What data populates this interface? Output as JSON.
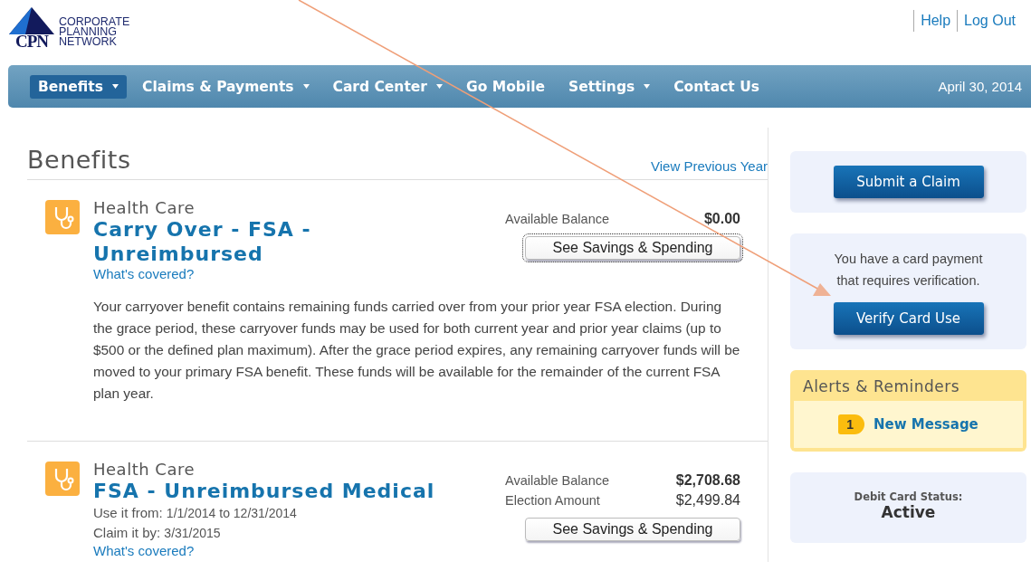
{
  "logo": {
    "mark": "CPN",
    "name_lines": [
      "CORPORATE",
      "PLANNING",
      "NETWORK"
    ]
  },
  "top_links": [
    "Help",
    "Log Out"
  ],
  "nav": {
    "items": [
      {
        "label": "Benefits",
        "selected": true,
        "has_menu": true
      },
      {
        "label": "Claims & Payments",
        "selected": false,
        "has_menu": true
      },
      {
        "label": "Card Center",
        "selected": false,
        "has_menu": true
      },
      {
        "label": "Go Mobile",
        "selected": false,
        "has_menu": false
      },
      {
        "label": "Settings",
        "selected": false,
        "has_menu": true
      },
      {
        "label": "Contact Us",
        "selected": false,
        "has_menu": false
      }
    ],
    "date": "April 30, 2014"
  },
  "page_title": "Benefits",
  "previous_year_link": "View Previous Year",
  "plans": [
    {
      "category": "Health Care",
      "title": "Carry Over - FSA - Unreimbursed",
      "covered_link": "What's covered?",
      "amounts": [
        {
          "label": "Available Balance",
          "value": "$0.00",
          "emphasis": true
        }
      ],
      "button": {
        "label": "See Savings & Spending",
        "focused": true
      },
      "description": "Your carryover benefit contains remaining funds carried over from your prior year FSA election. During the grace period, these carryover funds may be used for both current year and prior year claims (up to $500 or the defined plan maximum). After the grace period expires, any remaining carryover funds will be moved to your primary FSA benefit. These funds will be available for the remainder of the current FSA plan year."
    },
    {
      "category": "Health Care",
      "title": "FSA - Unreimbursed Medical",
      "details": [
        {
          "label": "Use it from:",
          "value": "1/1/2014 to 12/31/2014"
        },
        {
          "label": "Claim it by:",
          "value": "3/31/2015"
        }
      ],
      "covered_link": "What's covered?",
      "amounts": [
        {
          "label": "Available Balance",
          "value": "$2,708.68",
          "emphasis": true
        },
        {
          "label": "Election Amount",
          "value": "$2,499.84",
          "emphasis": false
        }
      ],
      "button": {
        "label": "See Savings & Spending",
        "focused": false
      }
    }
  ],
  "sidebar": {
    "submit_button": "Submit a Claim",
    "verify_message": "You have a card payment that requires verification.",
    "verify_button": "Verify Card Use",
    "alerts": {
      "title": "Alerts & Reminders",
      "count": "1",
      "message_link": "New Message"
    },
    "card_status": {
      "label": "Debit Card Status:",
      "value": "Active"
    }
  }
}
